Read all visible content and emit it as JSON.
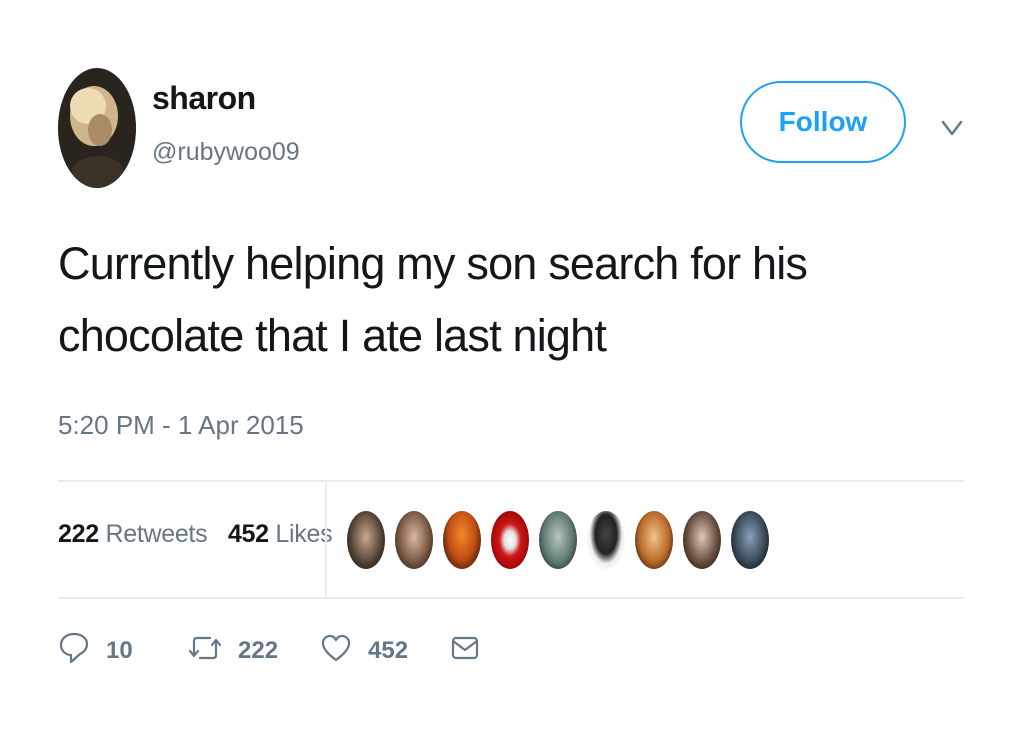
{
  "user": {
    "name": "sharon",
    "handle": "@rubywoo09"
  },
  "header": {
    "follow_label": "Follow"
  },
  "tweet": {
    "line1": "Currently helping my son search for his",
    "line2": "chocolate that I ate last night",
    "timestamp": "5:20 PM - 1 Apr 2015"
  },
  "stats": {
    "retweets_count": "222",
    "retweets_label": "Retweets",
    "likes_count": "452",
    "likes_label": "Likes"
  },
  "actions": {
    "reply_count": "10",
    "retweet_count": "222",
    "like_count": "452"
  },
  "icons": [
    "reply-icon",
    "retweet-icon",
    "heart-icon",
    "direct-message-icon",
    "chevron-down-icon"
  ],
  "colors": {
    "accent": "#1da1f2",
    "muted": "#657786",
    "text": "#14171a",
    "divider": "#e6ecf0"
  }
}
